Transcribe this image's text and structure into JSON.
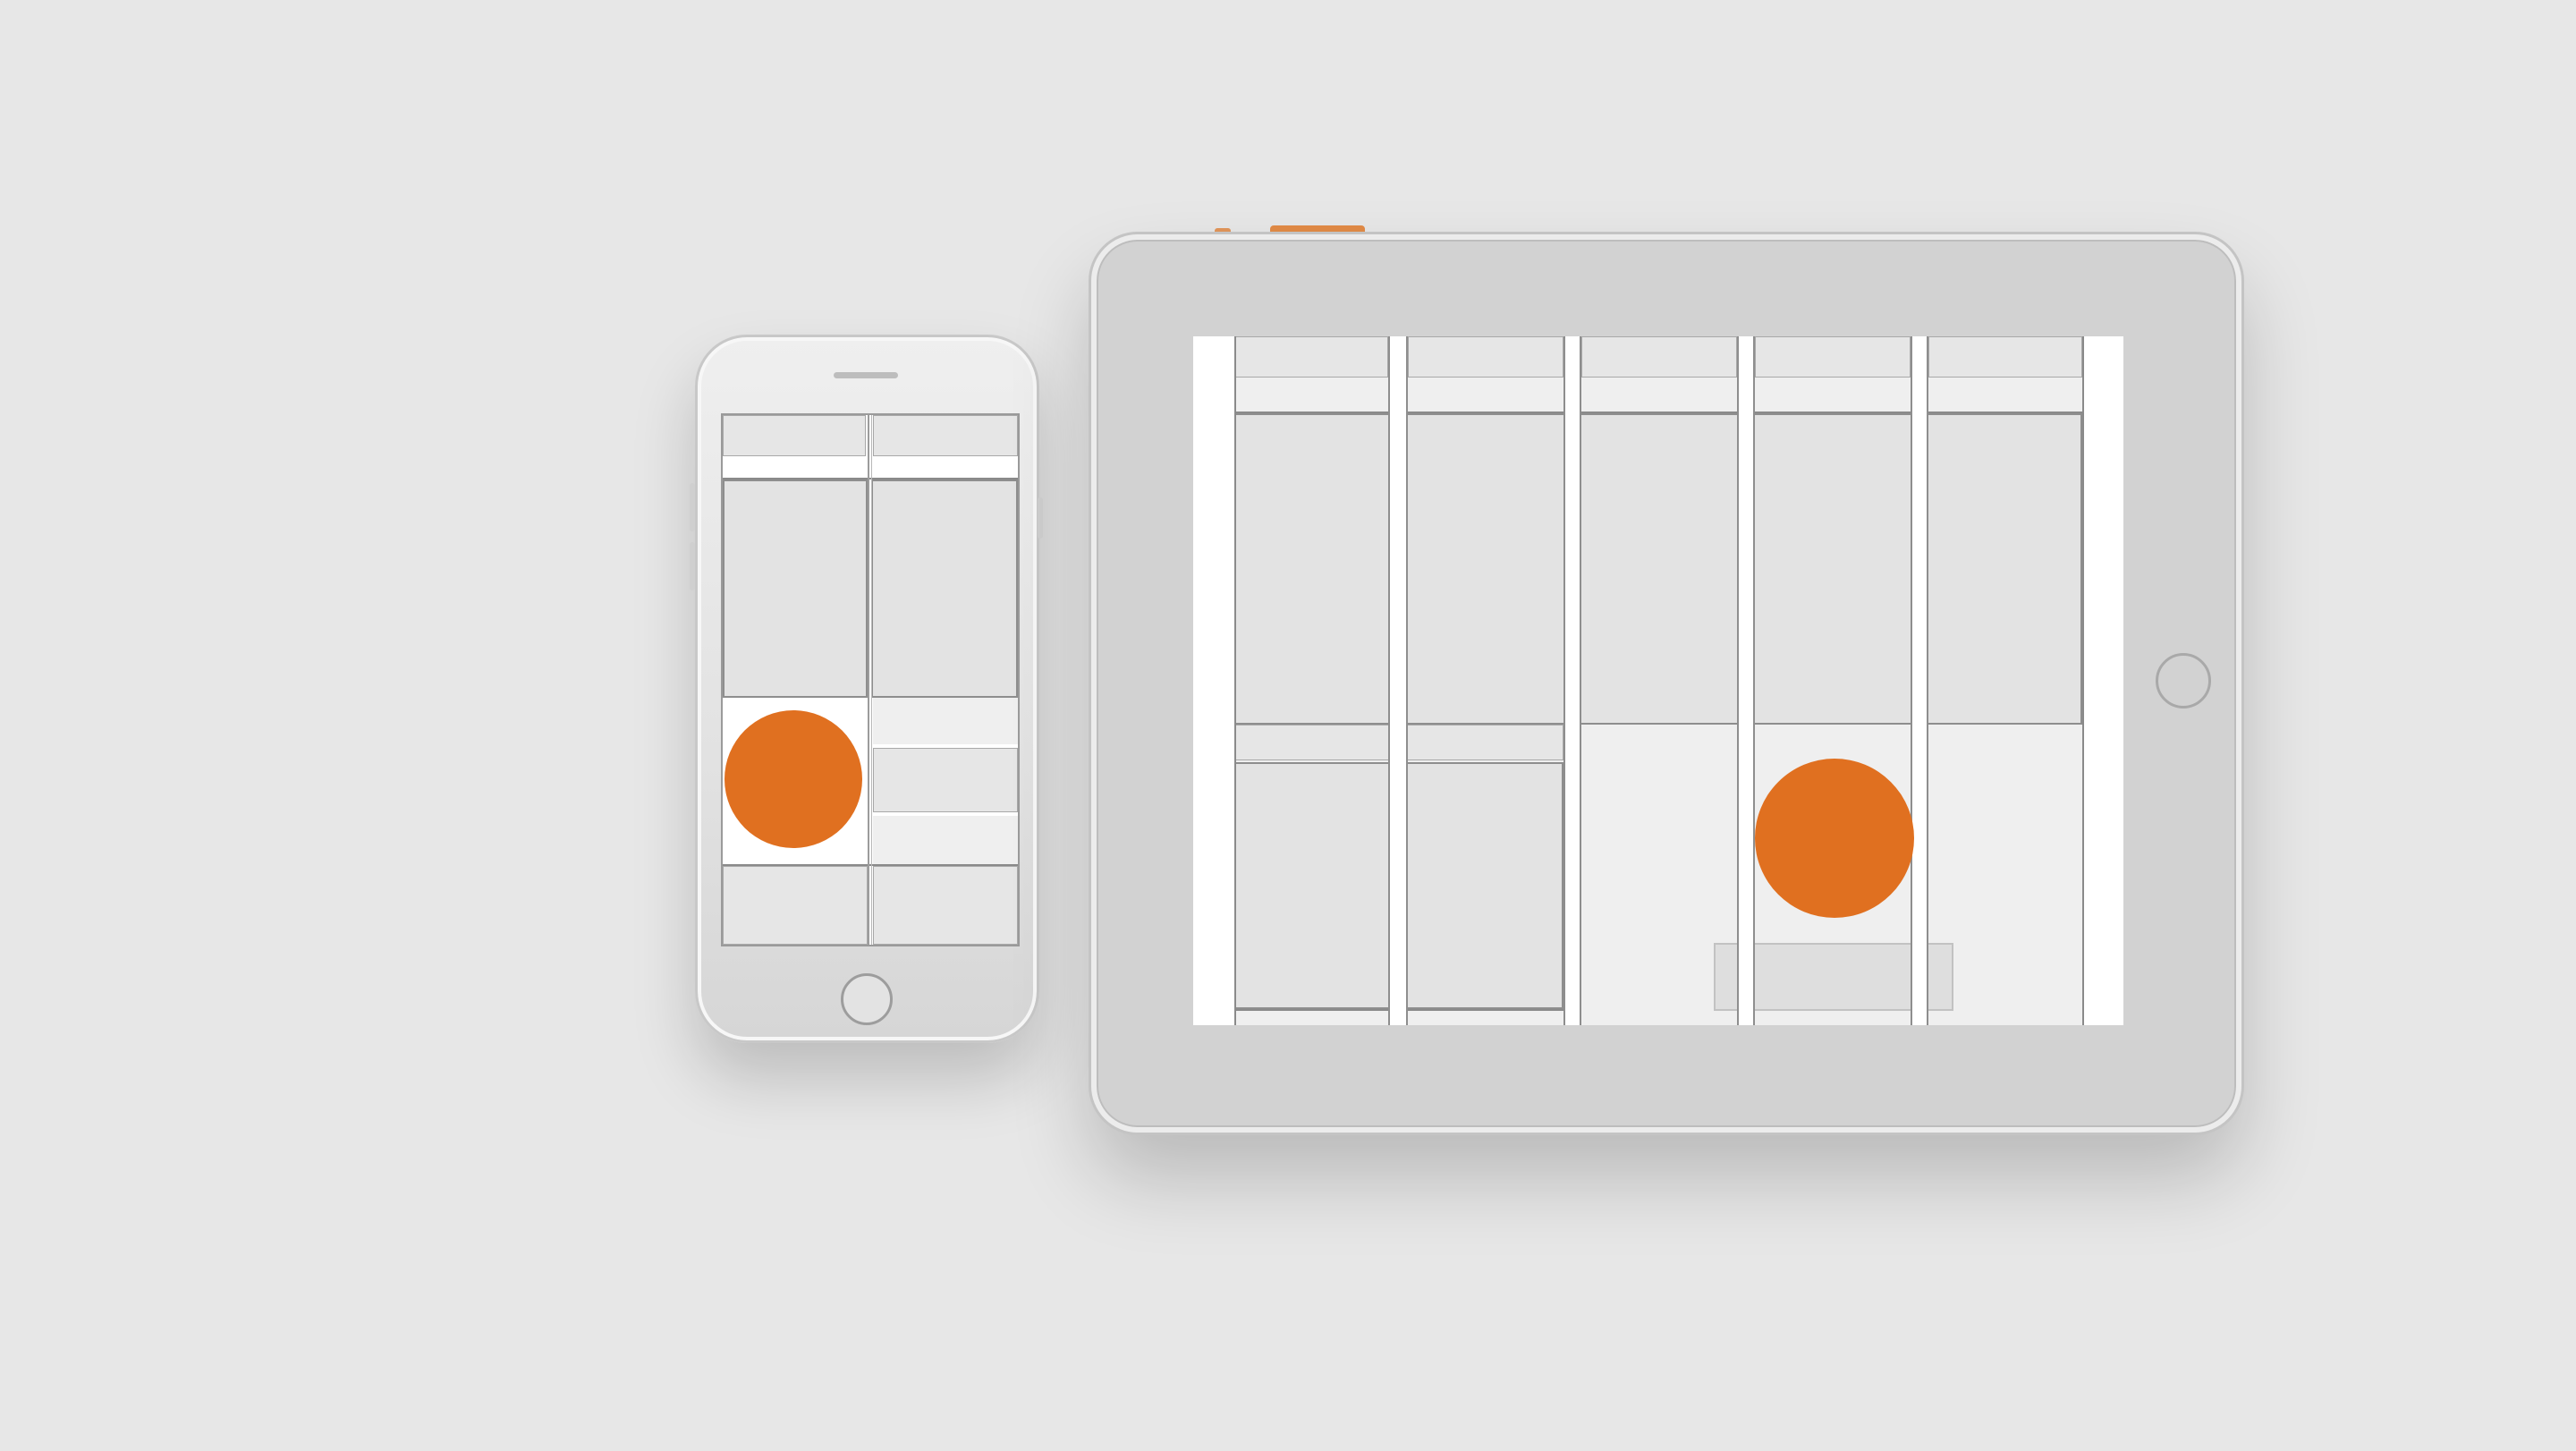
{
  "accent_color": "#e07020",
  "background_color": "#e7e7e7",
  "devices": [
    {
      "name": "phone",
      "icon": "home-button-icon",
      "screen_columns": 2
    },
    {
      "name": "tablet",
      "icon": "home-button-icon",
      "screen_columns": 5
    }
  ]
}
